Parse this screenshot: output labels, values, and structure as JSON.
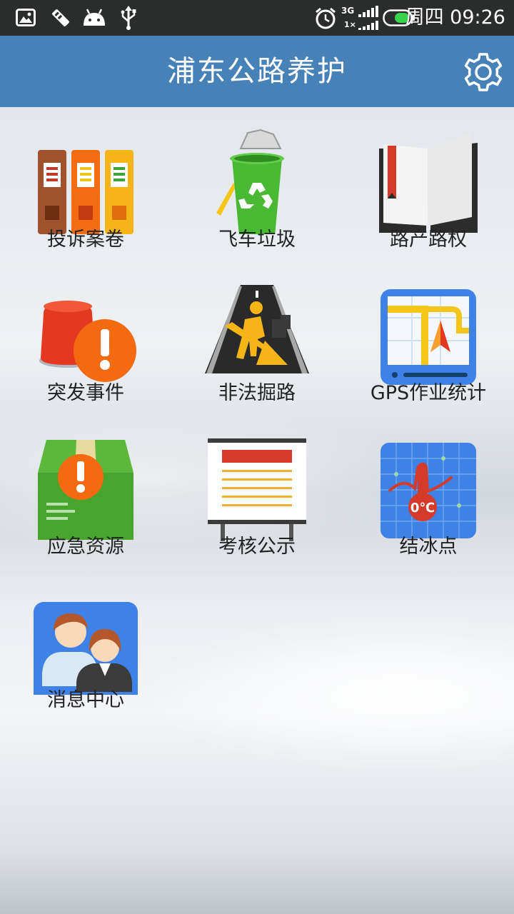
{
  "status_bar": {
    "clock": "周四 09:26",
    "network": "3G",
    "network_secondary": "1×",
    "icons": [
      "image-notification-icon",
      "usb-debug-icon",
      "android-icon",
      "usb-icon",
      "alarm-icon",
      "signal-icon",
      "battery-icon"
    ]
  },
  "header": {
    "title": "浦东公路养护",
    "settings_icon": "gear-icon"
  },
  "colors": {
    "header": "#4682b8",
    "status_bar": "#2a2d2c"
  },
  "grid": [
    {
      "label": "投诉案卷",
      "icon": "binders-icon"
    },
    {
      "label": "飞车垃圾",
      "icon": "recycle-bin-icon"
    },
    {
      "label": "路产路权",
      "icon": "open-book-icon"
    },
    {
      "label": "突发事件",
      "icon": "alarm-siren-icon"
    },
    {
      "label": "非法掘路",
      "icon": "road-worker-icon"
    },
    {
      "label": "GPS作业统计",
      "icon": "gps-map-icon"
    },
    {
      "label": "应急资源",
      "icon": "emergency-box-icon"
    },
    {
      "label": "考核公示",
      "icon": "notice-board-icon"
    },
    {
      "label": "结冰点",
      "icon": "thermometer-icon"
    },
    {
      "label": "消息中心",
      "icon": "contacts-icon"
    }
  ]
}
